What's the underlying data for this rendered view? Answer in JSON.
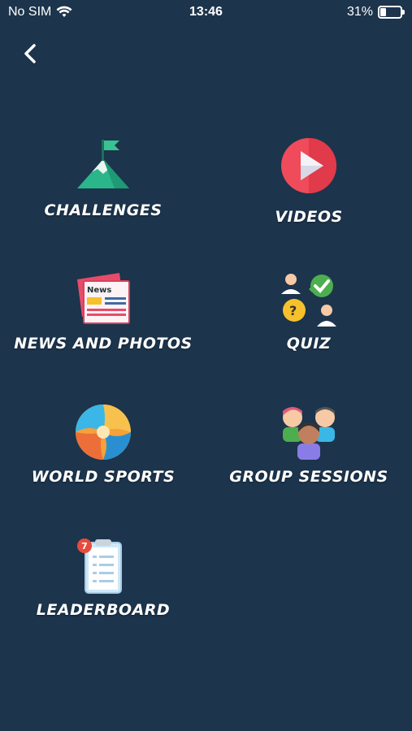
{
  "status_bar": {
    "carrier": "No SIM",
    "time": "13:46",
    "battery_percent": "31%",
    "battery_level": 0.31,
    "wifi_icon": "wifi-icon",
    "battery_icon": "battery-icon"
  },
  "nav": {
    "back_icon": "chevron-left-icon"
  },
  "menu": {
    "challenges": "CHALLENGES",
    "videos": "VIDEOS",
    "news_and_photos": "NEWS AND PHOTOS",
    "quiz": "QUIZ",
    "world_sports": "WORLD SPORTS",
    "group_sessions": "GROUP SESSIONS",
    "leaderboard": "LEADERBOARD",
    "leaderboard_badge": "7"
  },
  "colors": {
    "background": "#1c344c",
    "text": "#ffffff"
  }
}
